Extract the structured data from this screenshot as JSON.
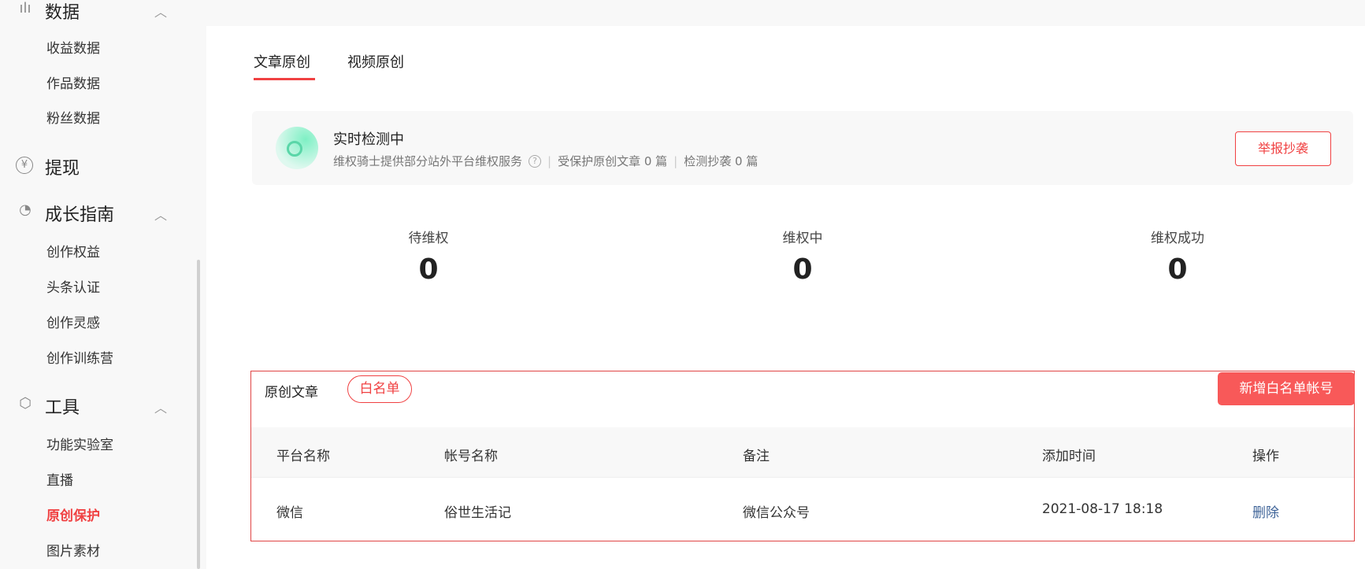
{
  "sidebar": {
    "sections": [
      {
        "label": "数据",
        "icon": "bar-chart-icon",
        "items": [
          "收益数据",
          "作品数据",
          "粉丝数据"
        ]
      },
      {
        "label": "提现",
        "icon": "yen-icon",
        "items": []
      },
      {
        "label": "成长指南",
        "icon": "growth-icon",
        "items": [
          "创作权益",
          "头条认证",
          "创作灵感",
          "创作训练营"
        ]
      },
      {
        "label": "工具",
        "icon": "cube-icon",
        "items": [
          "功能实验室",
          "直播",
          "原创保护",
          "图片素材"
        ]
      }
    ],
    "active": "原创保护"
  },
  "tabs": [
    "文章原创",
    "视频原创"
  ],
  "detect": {
    "title": "实时检测中",
    "desc": "维权骑士提供部分站外平台维权服务",
    "protected": "受保护原创文章 0 篇",
    "plagiarism": "检测抄袭 0 篇",
    "report": "举报抄袭"
  },
  "stats": [
    {
      "label": "待维权",
      "value": "0"
    },
    {
      "label": "维权中",
      "value": "0"
    },
    {
      "label": "维权成功",
      "value": "0"
    }
  ],
  "whitelist": {
    "title": "原创文章",
    "tag": "白名单",
    "add": "新增白名单帐号",
    "headers": [
      "平台名称",
      "帐号名称",
      "备注",
      "添加时间",
      "操作"
    ],
    "rows": [
      {
        "platform": "微信",
        "account": "俗世生活记",
        "note": "微信公众号",
        "time": "2021-08-17 18:18",
        "action": "删除"
      }
    ]
  },
  "colors": {
    "accent": "#f04142",
    "button": "#f85959",
    "link": "#406599"
  }
}
